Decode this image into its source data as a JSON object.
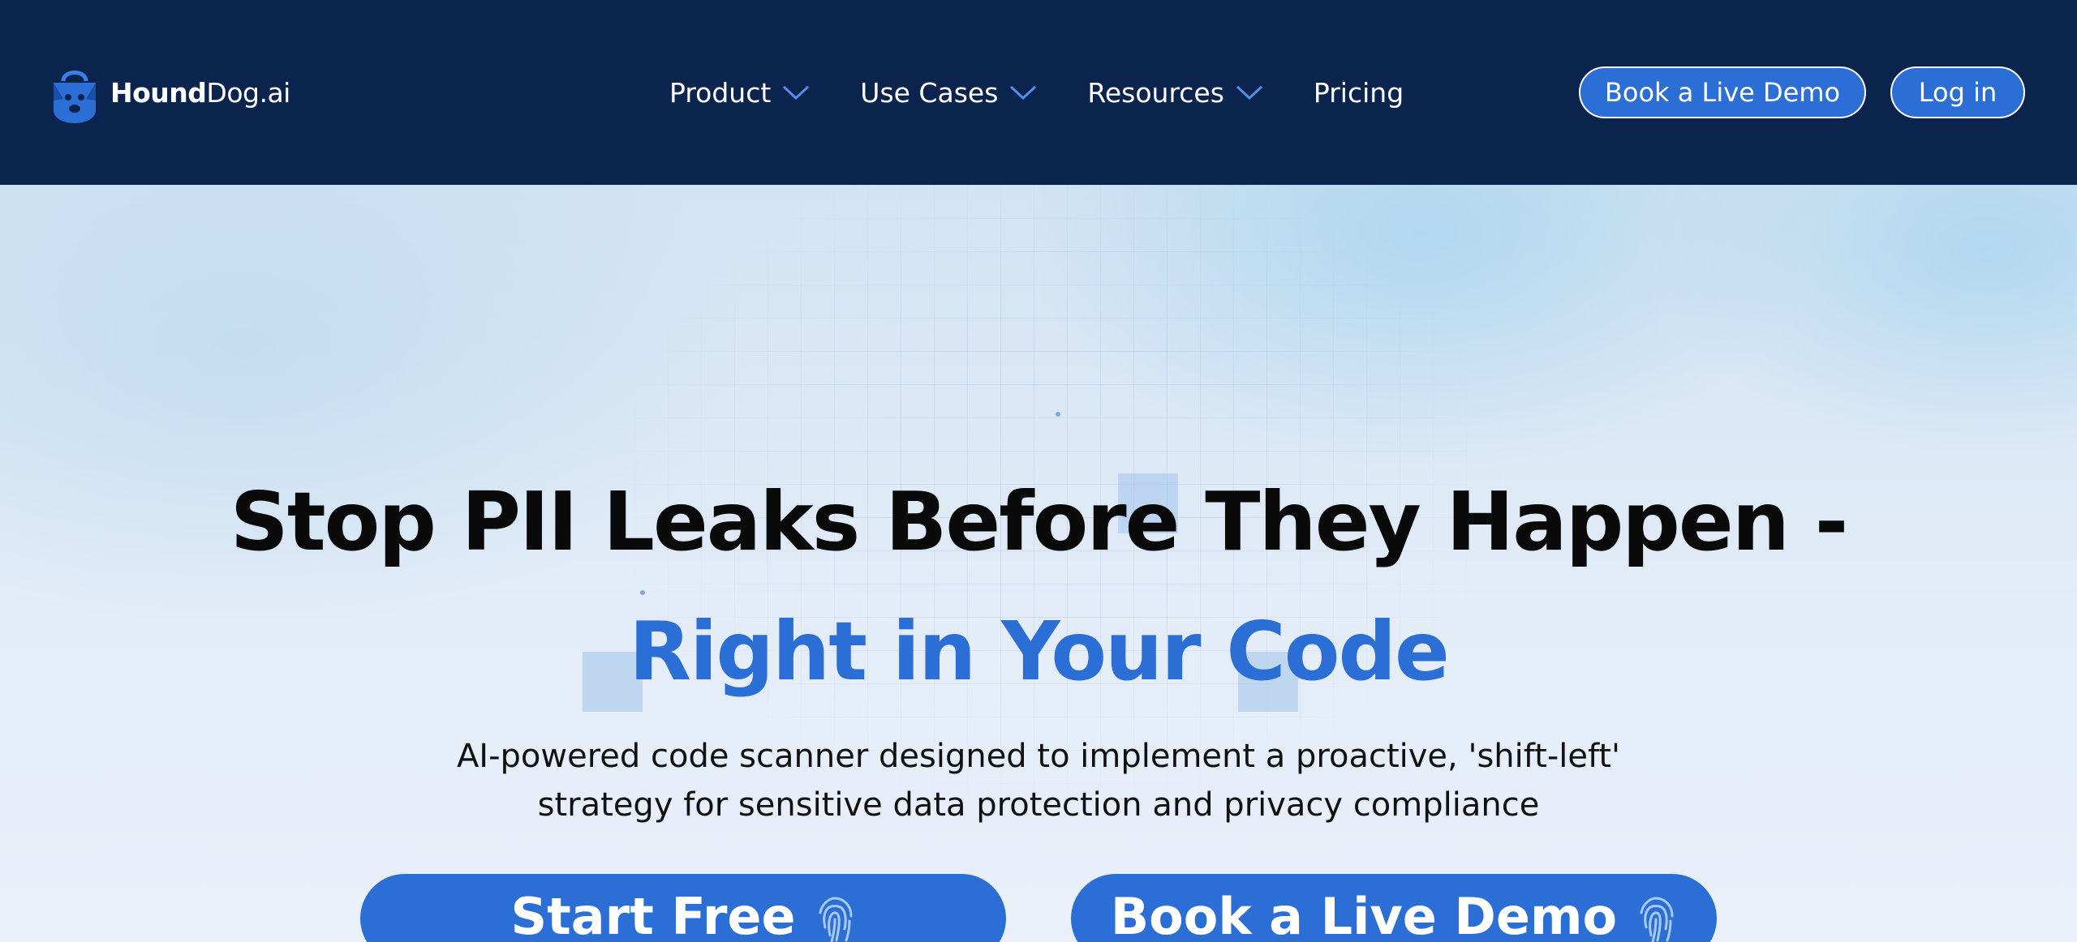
{
  "header": {
    "logo": {
      "bold": "Hound",
      "rest": "Dog.ai",
      "icon": "hound-lock-icon"
    },
    "nav": [
      {
        "label": "Product",
        "dropdown": true
      },
      {
        "label": "Use Cases",
        "dropdown": true
      },
      {
        "label": "Resources",
        "dropdown": true
      },
      {
        "label": "Pricing",
        "dropdown": false
      }
    ],
    "demo_button": "Book a Live Demo",
    "login_button": "Log in"
  },
  "hero": {
    "headline_line1": "Stop PII Leaks Before They Happen -",
    "headline_line2": "Right in Your Code",
    "subtitle_line1": "AI-powered code scanner designed to implement a proactive, 'shift-left'",
    "subtitle_line2": "strategy for sensitive data protection and privacy compliance",
    "cta_start": "Start Free",
    "cta_demo": "Book a Live Demo",
    "cta_icon": "fingerprint-icon"
  },
  "colors": {
    "header_bg": "#0b244e",
    "accent": "#2b6fd6",
    "chevron": "#4f8ff0",
    "headline": "#0a0a0a"
  }
}
